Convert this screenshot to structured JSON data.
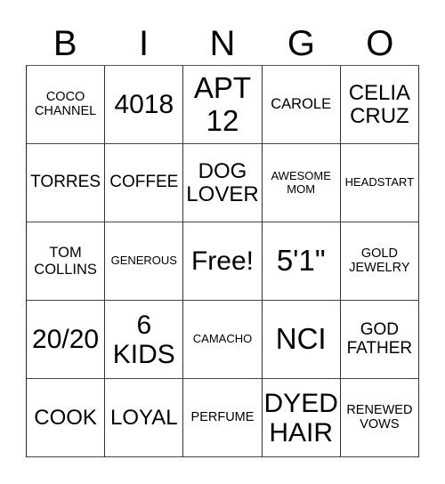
{
  "title_letters": [
    "B",
    "I",
    "N",
    "G",
    "O"
  ],
  "cells": [
    [
      "COCO\nCHANNEL",
      "4018",
      "APT\n12",
      "CAROLE",
      "CELIA\nCRUZ"
    ],
    [
      "TORRES",
      "COFFEE",
      "DOG\nLOVER",
      "AWESOME\nMOM",
      "HEADSTART"
    ],
    [
      "TOM\nCOLLINS",
      "GENEROUS",
      "Free!",
      "5'1\"",
      "GOLD\nJEWELRY"
    ],
    [
      "20/20",
      "6\nKIDS",
      "CAMACHO",
      "NCI",
      "GOD\nFATHER"
    ],
    [
      "COOK",
      "LOYAL",
      "PERFUME",
      "DYED\nHAIR",
      "RENEWED\nVOWS"
    ]
  ]
}
